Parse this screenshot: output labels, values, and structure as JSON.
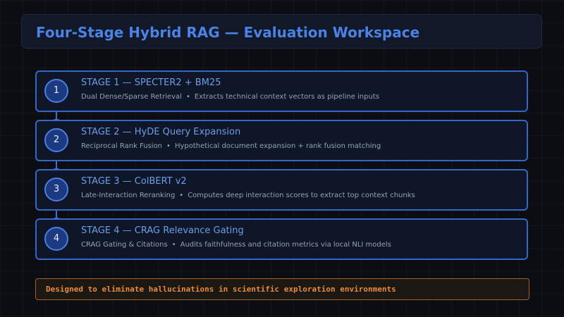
{
  "header": {
    "title": "Four-Stage Hybrid RAG — Evaluation Workspace"
  },
  "stages": [
    {
      "number": "1",
      "title": "STAGE 1 — SPECTER2 + BM25",
      "method": "Dual Dense/Sparse Retrieval",
      "separator": "•",
      "description": "Extracts technical context vectors as pipeline inputs"
    },
    {
      "number": "2",
      "title": "STAGE 2 — HyDE Query Expansion",
      "method": "Reciprocal Rank Fusion",
      "separator": "•",
      "description": "Hypothetical document expansion + rank fusion matching"
    },
    {
      "number": "3",
      "title": "STAGE 3 — ColBERT v2",
      "method": "Late-Interaction Reranking",
      "separator": "•",
      "description": "Computes deep interaction scores to extract top context chunks"
    },
    {
      "number": "4",
      "title": "STAGE 4 — CRAG Relevance Gating",
      "method": "CRAG Gating & Citations",
      "separator": "•",
      "description": "Audits faithfulness and citation metrics via local NLI models"
    }
  ],
  "footer": {
    "note": "Designed to eliminate hallucinations in scientific exploration environments"
  }
}
